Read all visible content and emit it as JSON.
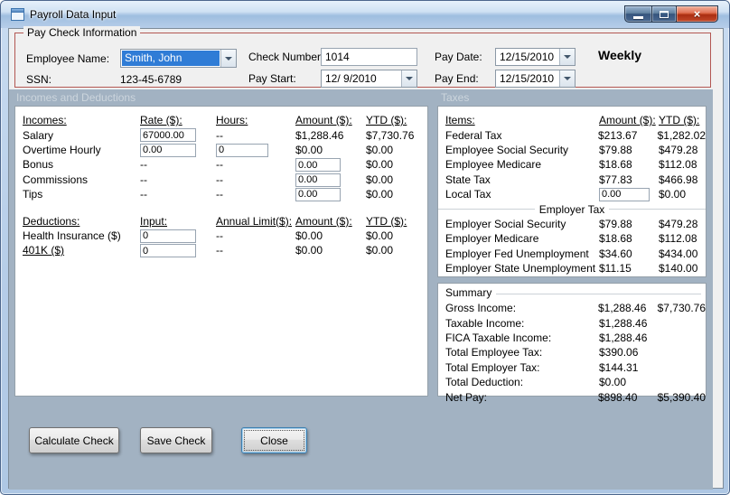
{
  "window": {
    "title": "Payroll Data Input"
  },
  "icons": {
    "close_glyph": "×"
  },
  "paycheck": {
    "group_title": "Pay Check Information",
    "employee_name": {
      "label": "Employee Name:",
      "value": "Smith, John"
    },
    "ssn": {
      "label": "SSN:",
      "value": "123-45-6789"
    },
    "check_number": {
      "label": "Check Number:",
      "value": "1014"
    },
    "pay_start": {
      "label": "Pay Start:",
      "value": "12/ 9/2010"
    },
    "pay_date": {
      "label": "Pay Date:",
      "value": "12/15/2010"
    },
    "pay_end": {
      "label": "Pay End:",
      "value": "12/15/2010"
    },
    "frequency": "Weekly"
  },
  "section_headers": {
    "incomes_deductions": "Incomes and Deductions",
    "taxes": "Taxes"
  },
  "incomes": {
    "headers": {
      "name": "Incomes:",
      "rate": "Rate ($):",
      "hours": "Hours:",
      "amount": "Amount ($):",
      "ytd": "YTD ($):"
    },
    "rows": [
      {
        "label": "Salary",
        "rate": "67000.00",
        "hours": "--",
        "amount": "$1,288.46",
        "ytd": "$7,730.76"
      },
      {
        "label": "Overtime Hourly",
        "rate": "0.00",
        "hours": "0",
        "amount": "$0.00",
        "ytd": "$0.00"
      },
      {
        "label": "Bonus",
        "rate": "--",
        "hours": "--",
        "amount": "0.00",
        "ytd": "$0.00"
      },
      {
        "label": "Commissions",
        "rate": "--",
        "hours": "--",
        "amount": "0.00",
        "ytd": "$0.00"
      },
      {
        "label": "Tips",
        "rate": "--",
        "hours": "--",
        "amount": "0.00",
        "ytd": "$0.00"
      }
    ]
  },
  "deductions": {
    "headers": {
      "name": "Deductions:",
      "input": "Input:",
      "limit": "Annual Limit($):",
      "amount": "Amount ($):",
      "ytd": "YTD ($):"
    },
    "rows": [
      {
        "label": "Health Insurance  ($)",
        "input": "0",
        "limit": "--",
        "amount": "$0.00",
        "ytd": "$0.00"
      },
      {
        "label": "401K  ($)",
        "input": "0",
        "limit": "--",
        "amount": "$0.00",
        "ytd": "$0.00"
      }
    ]
  },
  "taxes": {
    "headers": {
      "name": "Items:",
      "amount": "Amount ($):",
      "ytd": "YTD ($):"
    },
    "employee_rows": [
      {
        "label": "Federal Tax",
        "amount": "$213.67",
        "ytd": "$1,282.02"
      },
      {
        "label": "Employee Social Security",
        "amount": "$79.88",
        "ytd": "$479.28"
      },
      {
        "label": "Employee Medicare",
        "amount": "$18.68",
        "ytd": "$112.08"
      },
      {
        "label": "State Tax",
        "amount": "$77.83",
        "ytd": "$466.98"
      },
      {
        "label": "Local Tax",
        "amount": "0.00",
        "ytd": "$0.00"
      }
    ],
    "employer_divider": "Employer Tax",
    "employer_rows": [
      {
        "label": "Employer Social Security",
        "amount": "$79.88",
        "ytd": "$479.28"
      },
      {
        "label": "Employer Medicare",
        "amount": "$18.68",
        "ytd": "$112.08"
      },
      {
        "label": "Employer Fed Unemployment",
        "amount": "$34.60",
        "ytd": "$434.00"
      },
      {
        "label": "Employer State Unemployment",
        "amount": "$11.15",
        "ytd": "$140.00"
      }
    ]
  },
  "summary": {
    "group_title": "Summary",
    "rows": [
      {
        "label": "Gross Income:",
        "amount": "$1,288.46",
        "ytd": "$7,730.76"
      },
      {
        "label": "Taxable Income:",
        "amount": "$1,288.46",
        "ytd": ""
      },
      {
        "label": "FICA Taxable Income:",
        "amount": "$1,288.46",
        "ytd": ""
      },
      {
        "label": "Total Employee Tax:",
        "amount": "$390.06",
        "ytd": ""
      },
      {
        "label": "Total Employer Tax:",
        "amount": "$144.31",
        "ytd": ""
      },
      {
        "label": "Total Deduction:",
        "amount": "$0.00",
        "ytd": ""
      },
      {
        "label": "Net Pay:",
        "amount": "$898.40",
        "ytd": "$5,390.40"
      }
    ]
  },
  "buttons": {
    "calculate": "Calculate Check",
    "save": "Save Check",
    "close": "Close"
  },
  "colors": {
    "selection_blue": "#2f7cd6",
    "group_border_red": "#b35752",
    "panel_blue": "#a2b2c2"
  }
}
